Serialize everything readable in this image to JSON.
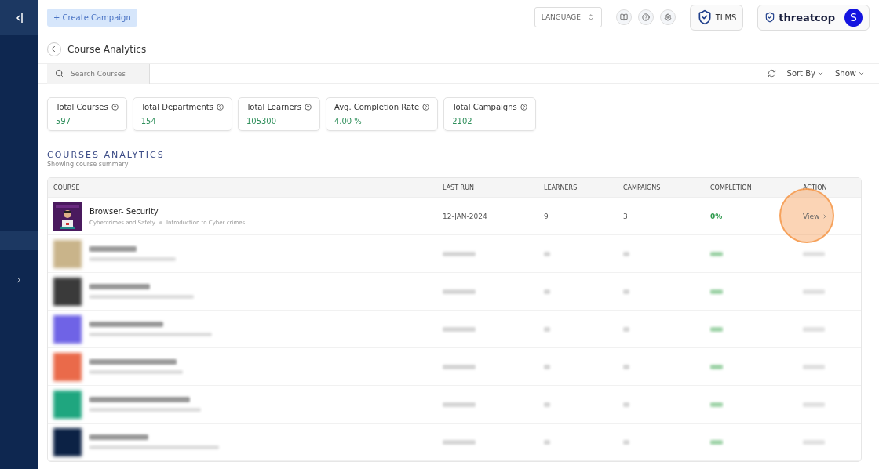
{
  "header": {
    "create_button": "+ Create Campaign",
    "language_select": "LANGUAGE",
    "tlms_label": "TLMS",
    "brand": "threatcop",
    "avatar_letter": "S"
  },
  "page": {
    "title": "Course Analytics"
  },
  "toolbar": {
    "search": {
      "placeholder": "Search Courses"
    },
    "sort_label": "Sort By",
    "show_label": "Show"
  },
  "stats": [
    {
      "label": "Total Courses",
      "value": "597"
    },
    {
      "label": "Total Departments",
      "value": "154"
    },
    {
      "label": "Total Learners",
      "value": "105300"
    },
    {
      "label": "Avg. Completion Rate",
      "value": "4.00 %"
    },
    {
      "label": "Total Campaigns",
      "value": "2102"
    }
  ],
  "section": {
    "title": "COURSES ANALYTICS",
    "subtitle": "Showing course summary"
  },
  "table": {
    "columns": [
      "COURSE",
      "LAST RUN",
      "LEARNERS",
      "CAMPAIGNS",
      "COMPLETION",
      "ACTION"
    ],
    "rows": [
      {
        "title": "Browser- Security",
        "category": "Cybercrimes and Safety",
        "module": "Introduction to Cyber crimes",
        "last_run": "12-JAN-2024",
        "learners": "9",
        "campaigns": "3",
        "completion": "0%",
        "action": "View",
        "highlighted": true
      }
    ],
    "blurred_rows": [
      {
        "color": "#c9b48a"
      },
      {
        "color": "#3a3a3a"
      },
      {
        "color": "#6f63e6"
      },
      {
        "color": "#ea6a4a"
      },
      {
        "color": "#1fa67f"
      },
      {
        "color": "#0c2245"
      }
    ]
  }
}
